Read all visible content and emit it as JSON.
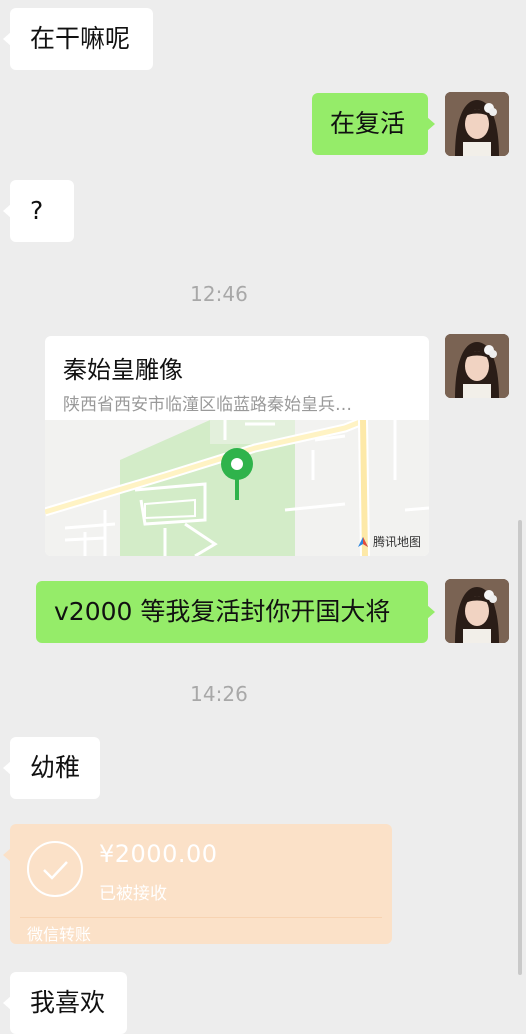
{
  "messages": {
    "m1": "在干嘛呢",
    "m2": "在复活",
    "m3": "?",
    "t1": "12:46",
    "m5": "v2000 等我复活封你开国大将",
    "t2": "14:26",
    "m6": "幼稚",
    "m8": "我喜欢"
  },
  "location": {
    "title": "秦始皇雕像",
    "address": "陕西省西安市临潼区临蓝路秦始皇兵…",
    "map_brand": "腾讯地图"
  },
  "transfer": {
    "amount": "¥2000.00",
    "status": "已被接收",
    "label": "微信转账"
  },
  "colors": {
    "background": "#ededed",
    "bubble_self": "#95ec69",
    "bubble_other": "#ffffff",
    "transfer_bg": "#fbe1c8",
    "timestamp": "#a8a8a8",
    "map_pin": "#2fb34b"
  },
  "icons": {
    "check": "check-circle-icon",
    "pin": "map-pin-icon",
    "map_logo": "tencent-map-logo-icon"
  }
}
